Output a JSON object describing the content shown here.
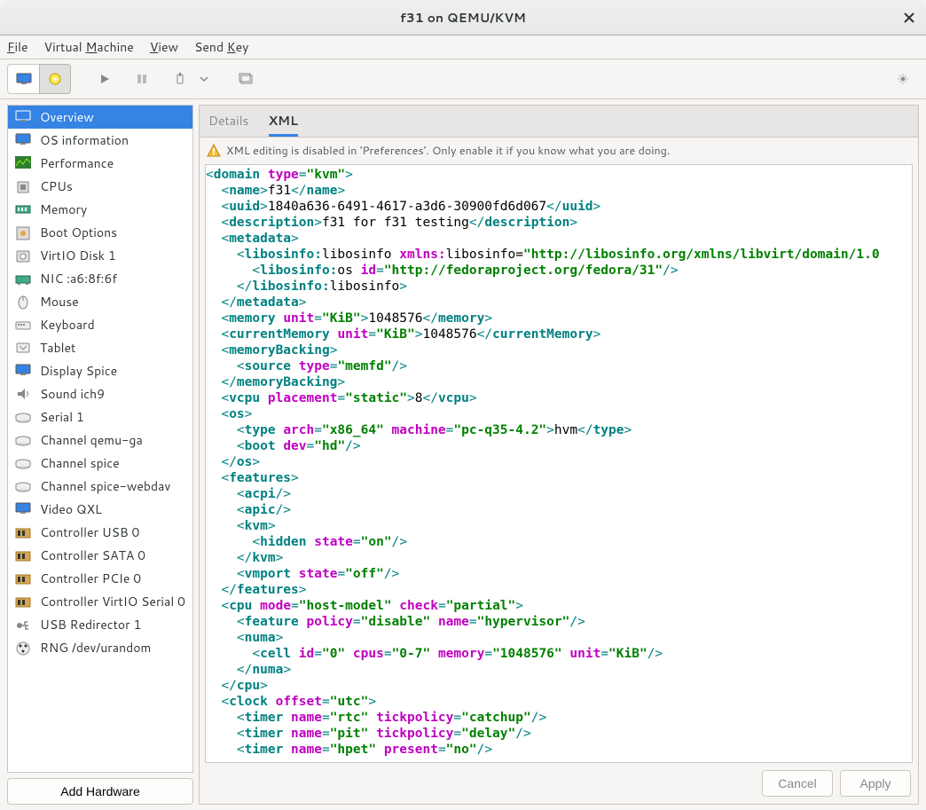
{
  "window": {
    "title": "f31 on QEMU/KVM"
  },
  "menu": {
    "file": "File",
    "file_mn": "F",
    "vm": "Virtual Machine",
    "vm_mn": "M",
    "view": "View",
    "view_mn": "V",
    "sendkey": "Send Key",
    "sendkey_mn": "K"
  },
  "tabs": {
    "details": "Details",
    "xml": "XML"
  },
  "warning": "XML editing is disabled in 'Preferences'. Only enable it if you know what you are doing.",
  "sidebar": {
    "items": [
      {
        "label": "Overview",
        "icon": "monitor",
        "selected": true
      },
      {
        "label": "OS information",
        "icon": "monitor"
      },
      {
        "label": "Performance",
        "icon": "perf"
      },
      {
        "label": "CPUs",
        "icon": "cpu"
      },
      {
        "label": "Memory",
        "icon": "memory"
      },
      {
        "label": "Boot Options",
        "icon": "boot"
      },
      {
        "label": "VirtIO Disk 1",
        "icon": "disk"
      },
      {
        "label": "NIC :a6:8f:6f",
        "icon": "nic"
      },
      {
        "label": "Mouse",
        "icon": "mouse"
      },
      {
        "label": "Keyboard",
        "icon": "keyboard"
      },
      {
        "label": "Tablet",
        "icon": "tablet"
      },
      {
        "label": "Display Spice",
        "icon": "display"
      },
      {
        "label": "Sound ich9",
        "icon": "sound"
      },
      {
        "label": "Serial 1",
        "icon": "serial"
      },
      {
        "label": "Channel qemu-ga",
        "icon": "serial"
      },
      {
        "label": "Channel spice",
        "icon": "serial"
      },
      {
        "label": "Channel spice-webdav",
        "icon": "serial"
      },
      {
        "label": "Video QXL",
        "icon": "monitor"
      },
      {
        "label": "Controller USB 0",
        "icon": "controller"
      },
      {
        "label": "Controller SATA 0",
        "icon": "controller"
      },
      {
        "label": "Controller PCIe 0",
        "icon": "controller"
      },
      {
        "label": "Controller VirtIO Serial 0",
        "icon": "controller"
      },
      {
        "label": "USB Redirector 1",
        "icon": "usb"
      },
      {
        "label": "RNG /dev/urandom",
        "icon": "rng"
      }
    ]
  },
  "buttons": {
    "add_hardware": "Add Hardware",
    "cancel": "Cancel",
    "apply": "Apply"
  },
  "xml_tokens": [
    [
      [
        "p",
        "<"
      ],
      [
        "t",
        "domain"
      ],
      [
        "p",
        " "
      ],
      [
        "a",
        "type"
      ],
      [
        "p",
        "="
      ],
      [
        "v",
        "\"kvm\""
      ],
      [
        "p",
        ">"
      ]
    ],
    [
      [
        "p",
        "  <"
      ],
      [
        "t",
        "name"
      ],
      [
        "p",
        ">"
      ],
      [
        "x",
        "f31"
      ],
      [
        "p",
        "</"
      ],
      [
        "t",
        "name"
      ],
      [
        "p",
        ">"
      ]
    ],
    [
      [
        "p",
        "  <"
      ],
      [
        "t",
        "uuid"
      ],
      [
        "p",
        ">"
      ],
      [
        "x",
        "1840a636-6491-4617-a3d6-30900fd6d067"
      ],
      [
        "p",
        "</"
      ],
      [
        "t",
        "uuid"
      ],
      [
        "p",
        ">"
      ]
    ],
    [
      [
        "p",
        "  <"
      ],
      [
        "t",
        "description"
      ],
      [
        "p",
        ">"
      ],
      [
        "x",
        "f31 for f31 testing"
      ],
      [
        "p",
        "</"
      ],
      [
        "t",
        "description"
      ],
      [
        "p",
        ">"
      ]
    ],
    [
      [
        "p",
        "  <"
      ],
      [
        "t",
        "metadata"
      ],
      [
        "p",
        ">"
      ]
    ],
    [
      [
        "p",
        "    <"
      ],
      [
        "t",
        "libosinfo:"
      ],
      [
        "x",
        "libosinfo "
      ],
      [
        "a",
        "xmlns:"
      ],
      [
        "x",
        "libosinfo="
      ],
      [
        "v",
        "\"http://libosinfo.org/xmlns/libvirt/domain/1.0"
      ]
    ],
    [
      [
        "p",
        "      <"
      ],
      [
        "t",
        "libosinfo:"
      ],
      [
        "x",
        "os "
      ],
      [
        "a",
        "id"
      ],
      [
        "p",
        "="
      ],
      [
        "v",
        "\"http://fedoraproject.org/fedora/31\""
      ],
      [
        "p",
        "/>"
      ]
    ],
    [
      [
        "p",
        "    </"
      ],
      [
        "t",
        "libosinfo:"
      ],
      [
        "x",
        "libosinfo"
      ],
      [
        "p",
        ">"
      ]
    ],
    [
      [
        "p",
        "  </"
      ],
      [
        "t",
        "metadata"
      ],
      [
        "p",
        ">"
      ]
    ],
    [
      [
        "p",
        "  <"
      ],
      [
        "t",
        "memory"
      ],
      [
        "p",
        " "
      ],
      [
        "a",
        "unit"
      ],
      [
        "p",
        "="
      ],
      [
        "v",
        "\"KiB\""
      ],
      [
        "p",
        ">"
      ],
      [
        "x",
        "1048576"
      ],
      [
        "p",
        "</"
      ],
      [
        "t",
        "memory"
      ],
      [
        "p",
        ">"
      ]
    ],
    [
      [
        "p",
        "  <"
      ],
      [
        "t",
        "currentMemory"
      ],
      [
        "p",
        " "
      ],
      [
        "a",
        "unit"
      ],
      [
        "p",
        "="
      ],
      [
        "v",
        "\"KiB\""
      ],
      [
        "p",
        ">"
      ],
      [
        "x",
        "1048576"
      ],
      [
        "p",
        "</"
      ],
      [
        "t",
        "currentMemory"
      ],
      [
        "p",
        ">"
      ]
    ],
    [
      [
        "p",
        "  <"
      ],
      [
        "t",
        "memoryBacking"
      ],
      [
        "p",
        ">"
      ]
    ],
    [
      [
        "p",
        "    <"
      ],
      [
        "t",
        "source"
      ],
      [
        "p",
        " "
      ],
      [
        "a",
        "type"
      ],
      [
        "p",
        "="
      ],
      [
        "v",
        "\"memfd\""
      ],
      [
        "p",
        "/>"
      ]
    ],
    [
      [
        "p",
        "  </"
      ],
      [
        "t",
        "memoryBacking"
      ],
      [
        "p",
        ">"
      ]
    ],
    [
      [
        "p",
        "  <"
      ],
      [
        "t",
        "vcpu"
      ],
      [
        "p",
        " "
      ],
      [
        "a",
        "placement"
      ],
      [
        "p",
        "="
      ],
      [
        "v",
        "\"static\""
      ],
      [
        "p",
        ">"
      ],
      [
        "x",
        "8"
      ],
      [
        "p",
        "</"
      ],
      [
        "t",
        "vcpu"
      ],
      [
        "p",
        ">"
      ]
    ],
    [
      [
        "p",
        "  <"
      ],
      [
        "t",
        "os"
      ],
      [
        "p",
        ">"
      ]
    ],
    [
      [
        "p",
        "    <"
      ],
      [
        "t",
        "type"
      ],
      [
        "p",
        " "
      ],
      [
        "a",
        "arch"
      ],
      [
        "p",
        "="
      ],
      [
        "v",
        "\"x86_64\""
      ],
      [
        "p",
        " "
      ],
      [
        "a",
        "machine"
      ],
      [
        "p",
        "="
      ],
      [
        "v",
        "\"pc-q35-4.2\""
      ],
      [
        "p",
        ">"
      ],
      [
        "x",
        "hvm"
      ],
      [
        "p",
        "</"
      ],
      [
        "t",
        "type"
      ],
      [
        "p",
        ">"
      ]
    ],
    [
      [
        "p",
        "    <"
      ],
      [
        "t",
        "boot"
      ],
      [
        "p",
        " "
      ],
      [
        "a",
        "dev"
      ],
      [
        "p",
        "="
      ],
      [
        "v",
        "\"hd\""
      ],
      [
        "p",
        "/>"
      ]
    ],
    [
      [
        "p",
        "  </"
      ],
      [
        "t",
        "os"
      ],
      [
        "p",
        ">"
      ]
    ],
    [
      [
        "p",
        "  <"
      ],
      [
        "t",
        "features"
      ],
      [
        "p",
        ">"
      ]
    ],
    [
      [
        "p",
        "    <"
      ],
      [
        "t",
        "acpi"
      ],
      [
        "p",
        "/>"
      ]
    ],
    [
      [
        "p",
        "    <"
      ],
      [
        "t",
        "apic"
      ],
      [
        "p",
        "/>"
      ]
    ],
    [
      [
        "p",
        "    <"
      ],
      [
        "t",
        "kvm"
      ],
      [
        "p",
        ">"
      ]
    ],
    [
      [
        "p",
        "      <"
      ],
      [
        "t",
        "hidden"
      ],
      [
        "p",
        " "
      ],
      [
        "a",
        "state"
      ],
      [
        "p",
        "="
      ],
      [
        "v",
        "\"on\""
      ],
      [
        "p",
        "/>"
      ]
    ],
    [
      [
        "p",
        "    </"
      ],
      [
        "t",
        "kvm"
      ],
      [
        "p",
        ">"
      ]
    ],
    [
      [
        "p",
        "    <"
      ],
      [
        "t",
        "vmport"
      ],
      [
        "p",
        " "
      ],
      [
        "a",
        "state"
      ],
      [
        "p",
        "="
      ],
      [
        "v",
        "\"off\""
      ],
      [
        "p",
        "/>"
      ]
    ],
    [
      [
        "p",
        "  </"
      ],
      [
        "t",
        "features"
      ],
      [
        "p",
        ">"
      ]
    ],
    [
      [
        "p",
        "  <"
      ],
      [
        "t",
        "cpu"
      ],
      [
        "p",
        " "
      ],
      [
        "a",
        "mode"
      ],
      [
        "p",
        "="
      ],
      [
        "v",
        "\"host-model\""
      ],
      [
        "p",
        " "
      ],
      [
        "a",
        "check"
      ],
      [
        "p",
        "="
      ],
      [
        "v",
        "\"partial\""
      ],
      [
        "p",
        ">"
      ]
    ],
    [
      [
        "p",
        "    <"
      ],
      [
        "t",
        "feature"
      ],
      [
        "p",
        " "
      ],
      [
        "a",
        "policy"
      ],
      [
        "p",
        "="
      ],
      [
        "v",
        "\"disable\""
      ],
      [
        "p",
        " "
      ],
      [
        "a",
        "name"
      ],
      [
        "p",
        "="
      ],
      [
        "v",
        "\"hypervisor\""
      ],
      [
        "p",
        "/>"
      ]
    ],
    [
      [
        "p",
        "    <"
      ],
      [
        "t",
        "numa"
      ],
      [
        "p",
        ">"
      ]
    ],
    [
      [
        "p",
        "      <"
      ],
      [
        "t",
        "cell"
      ],
      [
        "p",
        " "
      ],
      [
        "a",
        "id"
      ],
      [
        "p",
        "="
      ],
      [
        "v",
        "\"0\""
      ],
      [
        "p",
        " "
      ],
      [
        "a",
        "cpus"
      ],
      [
        "p",
        "="
      ],
      [
        "v",
        "\"0-7\""
      ],
      [
        "p",
        " "
      ],
      [
        "a",
        "memory"
      ],
      [
        "p",
        "="
      ],
      [
        "v",
        "\"1048576\""
      ],
      [
        "p",
        " "
      ],
      [
        "a",
        "unit"
      ],
      [
        "p",
        "="
      ],
      [
        "v",
        "\"KiB\""
      ],
      [
        "p",
        "/>"
      ]
    ],
    [
      [
        "p",
        "    </"
      ],
      [
        "t",
        "numa"
      ],
      [
        "p",
        ">"
      ]
    ],
    [
      [
        "p",
        "  </"
      ],
      [
        "t",
        "cpu"
      ],
      [
        "p",
        ">"
      ]
    ],
    [
      [
        "p",
        "  <"
      ],
      [
        "t",
        "clock"
      ],
      [
        "p",
        " "
      ],
      [
        "a",
        "offset"
      ],
      [
        "p",
        "="
      ],
      [
        "v",
        "\"utc\""
      ],
      [
        "p",
        ">"
      ]
    ],
    [
      [
        "p",
        "    <"
      ],
      [
        "t",
        "timer"
      ],
      [
        "p",
        " "
      ],
      [
        "a",
        "name"
      ],
      [
        "p",
        "="
      ],
      [
        "v",
        "\"rtc\""
      ],
      [
        "p",
        " "
      ],
      [
        "a",
        "tickpolicy"
      ],
      [
        "p",
        "="
      ],
      [
        "v",
        "\"catchup\""
      ],
      [
        "p",
        "/>"
      ]
    ],
    [
      [
        "p",
        "    <"
      ],
      [
        "t",
        "timer"
      ],
      [
        "p",
        " "
      ],
      [
        "a",
        "name"
      ],
      [
        "p",
        "="
      ],
      [
        "v",
        "\"pit\""
      ],
      [
        "p",
        " "
      ],
      [
        "a",
        "tickpolicy"
      ],
      [
        "p",
        "="
      ],
      [
        "v",
        "\"delay\""
      ],
      [
        "p",
        "/>"
      ]
    ],
    [
      [
        "p",
        "    <"
      ],
      [
        "t",
        "timer"
      ],
      [
        "p",
        " "
      ],
      [
        "a",
        "name"
      ],
      [
        "p",
        "="
      ],
      [
        "v",
        "\"hpet\""
      ],
      [
        "p",
        " "
      ],
      [
        "a",
        "present"
      ],
      [
        "p",
        "="
      ],
      [
        "v",
        "\"no\""
      ],
      [
        "p",
        "/>"
      ]
    ]
  ]
}
